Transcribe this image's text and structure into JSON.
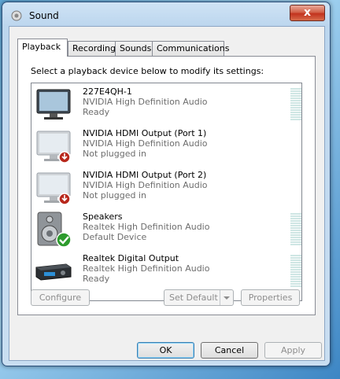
{
  "window": {
    "title": "Sound",
    "close_glyph": "x"
  },
  "tabs": [
    {
      "label": "Playback"
    },
    {
      "label": "Recording"
    },
    {
      "label": "Sounds"
    },
    {
      "label": "Communications"
    }
  ],
  "panel": {
    "instruction": "Select a playback device below to modify its settings:"
  },
  "devices": [
    {
      "name": "227E4QH-1",
      "driver": "NVIDIA High Definition Audio",
      "status": "Ready",
      "icon": "monitor-icon"
    },
    {
      "name": "NVIDIA HDMI Output (Port 1)",
      "driver": "NVIDIA High Definition Audio",
      "status": "Not plugged in",
      "icon": "monitor-unplugged-icon"
    },
    {
      "name": "NVIDIA HDMI Output (Port 2)",
      "driver": "NVIDIA High Definition Audio",
      "status": "Not plugged in",
      "icon": "monitor-unplugged-icon"
    },
    {
      "name": "Speakers",
      "driver": "Realtek High Definition Audio",
      "status": "Default Device",
      "icon": "speaker-default-icon"
    },
    {
      "name": "Realtek Digital Output",
      "driver": "Realtek High Definition Audio",
      "status": "Ready",
      "icon": "receiver-icon"
    }
  ],
  "panel_buttons": {
    "configure": "Configure",
    "set_default": "Set Default",
    "properties": "Properties"
  },
  "dialog_buttons": {
    "ok": "OK",
    "cancel": "Cancel",
    "apply": "Apply"
  }
}
